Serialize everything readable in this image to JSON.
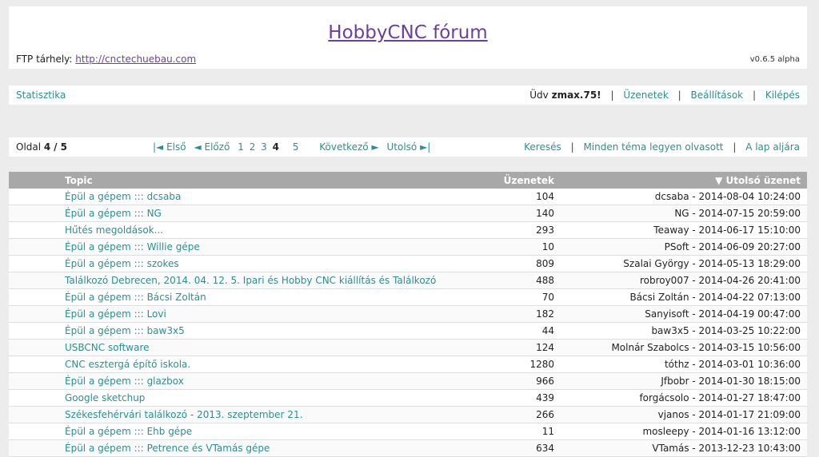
{
  "header": {
    "title": "HobbyCNC fórum",
    "ftp_label": "FTP tárhely:",
    "ftp_link": "http://cnctechuebau.com",
    "version": "v0.6.5 alpha"
  },
  "nav": {
    "stats": "Statisztika",
    "greeting_prefix": "Üdv",
    "username": "zmax.75!",
    "messages": "Üzenetek",
    "settings": "Beállítások",
    "logout": "Kilépés"
  },
  "pager": {
    "page_label": "Oldal",
    "current": "4",
    "of": "/ 5",
    "first": "|◄ Első",
    "prev": "◄ Előző",
    "pages": [
      "1",
      "2",
      "3",
      "4",
      "5"
    ],
    "next": "Következő ►",
    "last": "Utolsó ►|",
    "search": "Keresés",
    "mark_read": "Minden téma legyen olvasott",
    "bottom": "A lap aljára"
  },
  "table": {
    "headers": {
      "topic": "Topic",
      "count": "Üzenetek",
      "last": "▼ Utolsó üzenet"
    },
    "rows": [
      {
        "topic": "Épül a gépem ::: dcsaba",
        "count": "104",
        "last": "dcsaba - 2014-08-04 10:24:00"
      },
      {
        "topic": "Épül a gépem ::: NG",
        "count": "140",
        "last": "NG - 2014-07-15 20:59:00"
      },
      {
        "topic": "Hűtés megoldások...",
        "count": "293",
        "last": "Teaway - 2014-06-17 15:10:00"
      },
      {
        "topic": "Épül a gépem ::: Willie gépe",
        "count": "10",
        "last": "PSoft - 2014-06-09 20:27:00"
      },
      {
        "topic": "Épül a gépem ::: szokes",
        "count": "809",
        "last": "Szalai György - 2014-05-13 18:29:00"
      },
      {
        "topic": "Találkozó Debrecen, 2014. 04. 12. 5. Ipari és Hobby CNC kiállítás és Találkozó",
        "count": "488",
        "last": "robroy007 - 2014-04-26 20:41:00"
      },
      {
        "topic": "Épül a gépem ::: Bácsi Zoltán",
        "count": "70",
        "last": "Bácsi Zoltán - 2014-04-22 07:13:00"
      },
      {
        "topic": "Épül a gépem ::: Lovi",
        "count": "182",
        "last": "Sanyisoft - 2014-04-19 00:47:00"
      },
      {
        "topic": "Épül a gépem ::: baw3x5",
        "count": "44",
        "last": "baw3x5 - 2014-03-25 10:22:00"
      },
      {
        "topic": "USBCNC software",
        "count": "124",
        "last": "Molnár Szabolcs - 2014-03-15 10:56:00"
      },
      {
        "topic": "CNC esztergá építő iskola.",
        "count": "1280",
        "last": "tóthz - 2014-03-01 10:36:00"
      },
      {
        "topic": "Épül a gépem ::: glazbox",
        "count": "966",
        "last": "Jfbobr - 2014-01-30 18:15:00"
      },
      {
        "topic": "Google sketchup",
        "count": "439",
        "last": "forgácsolo - 2014-01-27 18:47:00"
      },
      {
        "topic": "Székesfehérvári találkozó - 2013. szeptember 21.",
        "count": "266",
        "last": "vjanos - 2014-01-17 21:09:00"
      },
      {
        "topic": "Épül a gépem ::: Ehb gépe",
        "count": "11",
        "last": "mosleepy - 2014-01-16 13:12:00"
      },
      {
        "topic": "Épül a gépem ::: Petrence és VTamás gépe",
        "count": "634",
        "last": "VTamás - 2013-12-23 10:43:00"
      }
    ]
  }
}
